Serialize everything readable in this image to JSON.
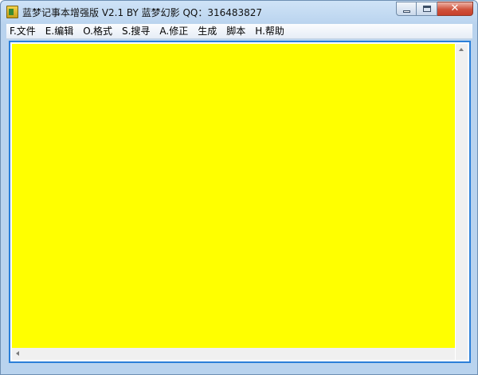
{
  "window": {
    "title": "蓝梦记事本增强版 V2.1 BY 蓝梦幻影 QQ：316483827",
    "icon": "notepad-app-icon"
  },
  "menu": {
    "items": [
      "F.文件",
      "E.编辑",
      "O.格式",
      "S.搜寻",
      "A.修正",
      "生成",
      "脚本",
      "H.帮助"
    ]
  },
  "editor": {
    "content": "",
    "background_color": "#ffff00",
    "border_color": "#2b7fd8"
  },
  "window_controls": {
    "minimize_icon": "minimize-icon",
    "maximize_icon": "maximize-icon",
    "close_icon": "close-icon"
  }
}
